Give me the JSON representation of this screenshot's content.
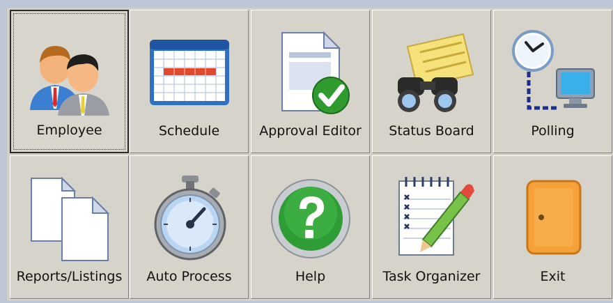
{
  "tiles": [
    {
      "label": "Employee",
      "icon": "employees-icon"
    },
    {
      "label": "Schedule",
      "icon": "calendar-icon"
    },
    {
      "label": "Approval Editor",
      "icon": "document-check-icon"
    },
    {
      "label": "Status Board",
      "icon": "binoculars-note-icon"
    },
    {
      "label": "Polling",
      "icon": "clock-computer-icon"
    },
    {
      "label": "Reports/Listings",
      "icon": "documents-icon"
    },
    {
      "label": "Auto Process",
      "icon": "stopwatch-icon"
    },
    {
      "label": "Help",
      "icon": "help-icon"
    },
    {
      "label": "Task Organizer",
      "icon": "notepad-pencil-icon"
    },
    {
      "label": "Exit",
      "icon": "door-icon"
    }
  ],
  "selected": "Employee"
}
